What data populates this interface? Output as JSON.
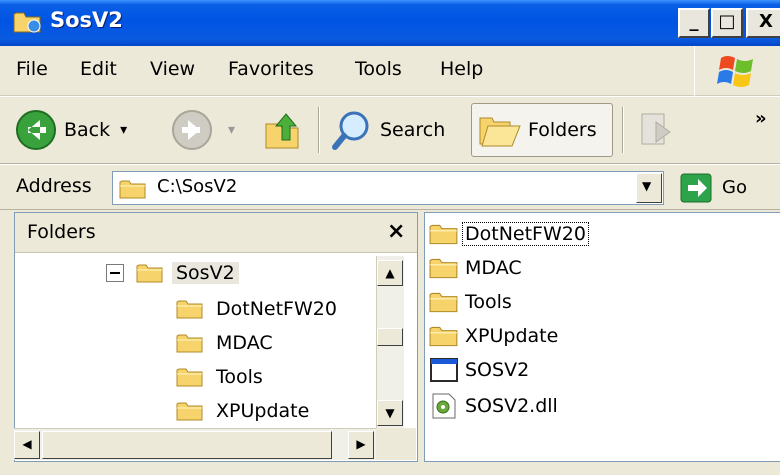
{
  "window": {
    "title": "SosV2",
    "min_glyph": "_",
    "max_glyph": "□",
    "close_glyph": "X"
  },
  "menu": {
    "items": [
      "File",
      "Edit",
      "View",
      "Favorites",
      "Tools",
      "Help"
    ]
  },
  "toolbar": {
    "back_label": "Back",
    "search_label": "Search",
    "folders_label": "Folders",
    "more_glyph": "»",
    "back_dropdown_glyph": "▾",
    "forward_dropdown_glyph": "▾"
  },
  "address": {
    "label": "Address",
    "value": "C:\\SosV2",
    "go_label": "Go",
    "dropdown_glyph": "▼"
  },
  "folders_pane": {
    "title": "Folders",
    "close_glyph": "×",
    "root": "SosV2",
    "children": [
      "DotNetFW20",
      "MDAC",
      "Tools",
      "XPUpdate"
    ]
  },
  "scrollbars": {
    "up": "▲",
    "down": "▼",
    "left": "◀",
    "right": "▶"
  },
  "files": [
    {
      "name": "DotNetFW20",
      "icon": "folder-icon"
    },
    {
      "name": "MDAC",
      "icon": "folder-icon"
    },
    {
      "name": "Tools",
      "icon": "folder-icon"
    },
    {
      "name": "XPUpdate",
      "icon": "folder-icon"
    },
    {
      "name": "SOSV2",
      "icon": "application-icon"
    },
    {
      "name": "SOSV2.dll",
      "icon": "dll-icon"
    }
  ],
  "colors": {
    "titlebar": "#0054e3",
    "folder": "#f6d46b",
    "selection": "#e8e6dd",
    "go_green": "#2da44a"
  }
}
